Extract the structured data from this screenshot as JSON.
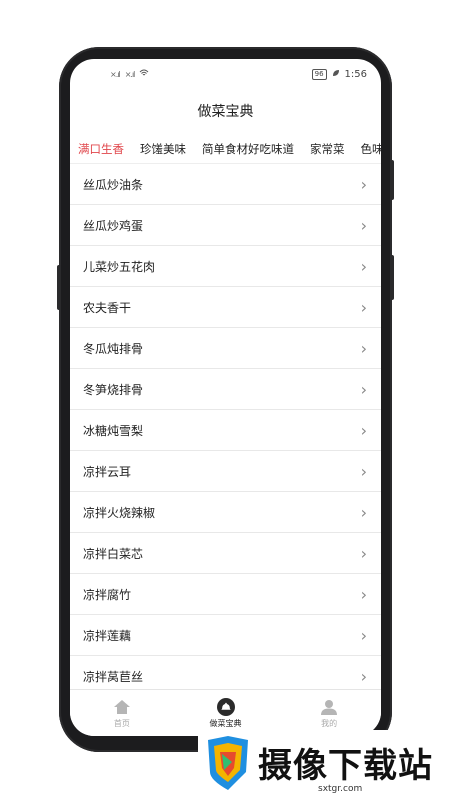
{
  "status": {
    "time": "1:56",
    "battery": "96",
    "signal_left": "×.ıl",
    "signal_right": "×.ıl",
    "wifi_glyph": "📶"
  },
  "title": "做菜宝典",
  "tabs": [
    {
      "label": "满口生香",
      "active": true
    },
    {
      "label": "珍馐美味"
    },
    {
      "label": "简单食材好吃味道"
    },
    {
      "label": "家常菜"
    },
    {
      "label": "色味"
    }
  ],
  "items": [
    "丝瓜炒油条",
    "丝瓜炒鸡蛋",
    "儿菜炒五花肉",
    "农夫香干",
    "冬瓜炖排骨",
    "冬笋烧排骨",
    "冰糖炖雪梨",
    "凉拌云耳",
    "凉拌火烧辣椒",
    "凉拌白菜芯",
    "凉拌腐竹",
    "凉拌莲藕",
    "凉拌莴苣丝"
  ],
  "nav": [
    {
      "label": "首页",
      "icon": "home-icon"
    },
    {
      "label": "做菜宝典",
      "icon": "cloche-icon",
      "active": true
    },
    {
      "label": "我的",
      "icon": "user-icon"
    }
  ],
  "colors": {
    "accent": "#e0474c"
  },
  "watermark": {
    "text": "摄像下载站",
    "url": "sxtgr.com"
  }
}
